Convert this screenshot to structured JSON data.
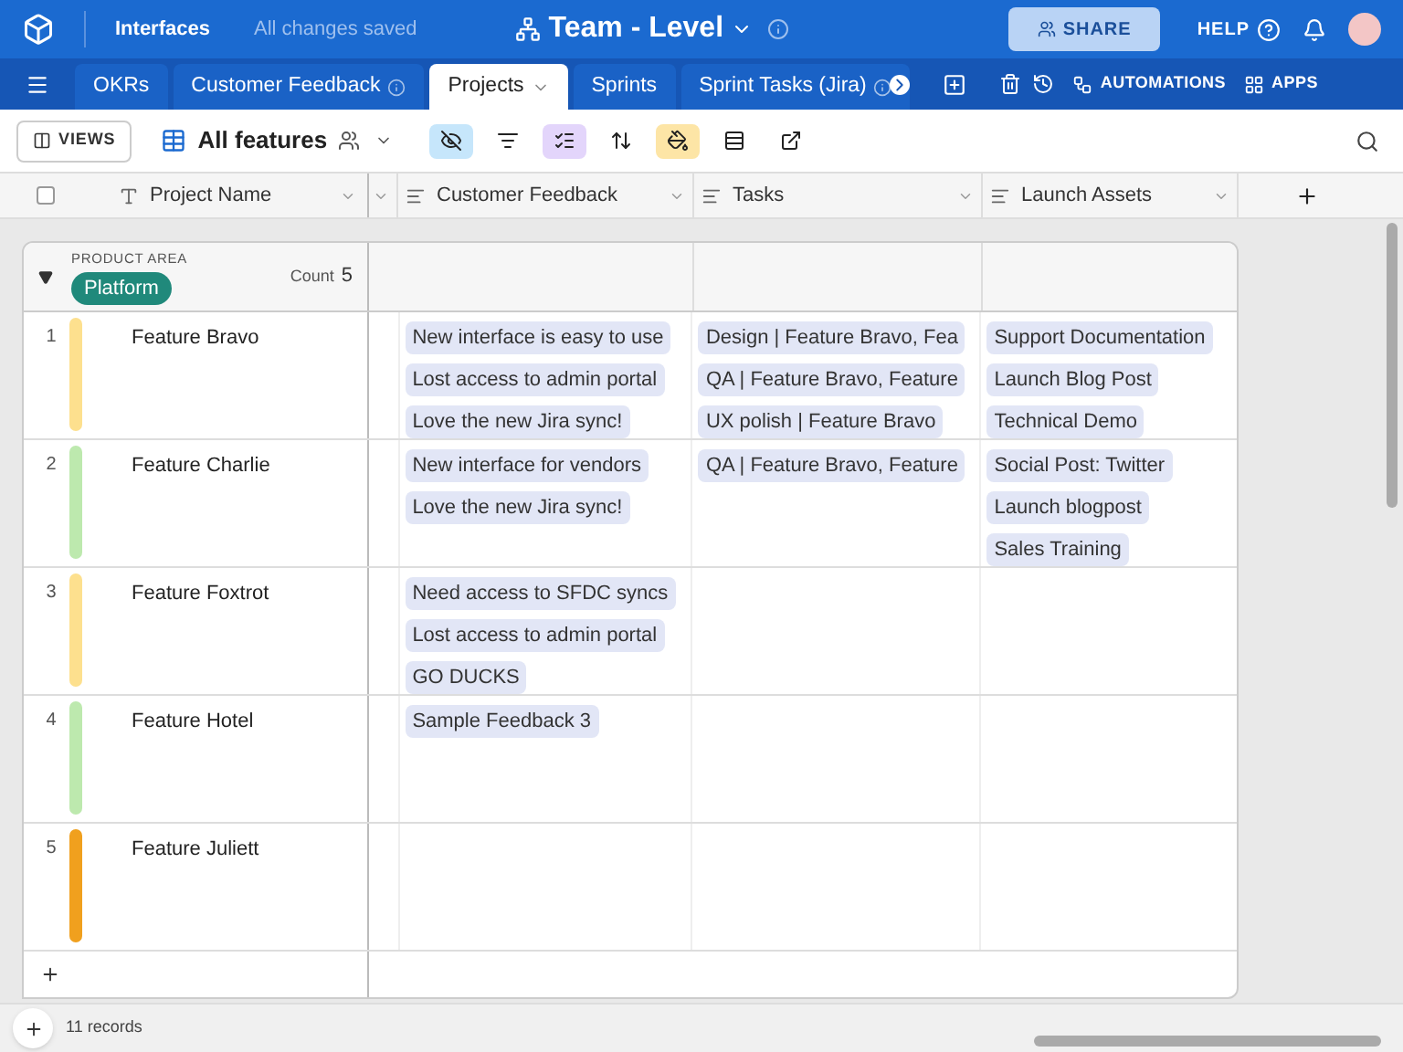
{
  "topbar": {
    "interfaces": "Interfaces",
    "status": "All changes saved",
    "title": "Team - Level",
    "share": "SHARE",
    "help": "HELP"
  },
  "tabs": [
    {
      "label": "OKRs",
      "selected": false,
      "info": false
    },
    {
      "label": "Customer Feedback",
      "selected": false,
      "info": true
    },
    {
      "label": "Projects",
      "selected": true,
      "info": false
    },
    {
      "label": "Sprints",
      "selected": false,
      "info": false
    },
    {
      "label": "Sprint Tasks (Jira)",
      "selected": false,
      "info": true
    }
  ],
  "tab_actions": {
    "automations": "AUTOMATIONS",
    "apps": "APPS"
  },
  "toolbar": {
    "views": "VIEWS",
    "view_name": "All features",
    "tools": [
      {
        "kind": "hide",
        "active": true,
        "color": "#c6e6fb"
      },
      {
        "kind": "filter",
        "active": false
      },
      {
        "kind": "group",
        "active": true,
        "color": "#e3d5fb"
      },
      {
        "kind": "sort",
        "active": false
      },
      {
        "kind": "color",
        "active": true,
        "color": "#fde5a6"
      },
      {
        "kind": "height",
        "active": false
      },
      {
        "kind": "share",
        "active": false
      }
    ]
  },
  "select_all": {
    "checked": false
  },
  "columns": [
    "Project Name",
    "Customer Feedback",
    "Tasks",
    "Launch Assets"
  ],
  "group": {
    "field": "PRODUCT AREA",
    "value": "Platform",
    "count_label": "Count",
    "count": "5",
    "expanded": true
  },
  "rows": [
    {
      "number": "1",
      "name": "Feature Bravo",
      "color": "#fde08e",
      "feedback": [
        "New interface is easy to use",
        "Lost access to admin portal",
        "Love the new Jira sync!"
      ],
      "tasks": [
        "Design | Feature Bravo, Fea",
        "QA | Feature Bravo, Feature",
        "UX polish | Feature Bravo"
      ],
      "assets": [
        "Support Documentation",
        "Launch Blog Post",
        "Technical Demo"
      ]
    },
    {
      "number": "2",
      "name": "Feature Charlie",
      "color": "#bde9ae",
      "feedback": [
        "New interface for vendors",
        "Love the new Jira sync!"
      ],
      "tasks": [
        "QA | Feature Bravo, Feature"
      ],
      "assets": [
        "Social Post: Twitter",
        "Launch blogpost",
        "Sales Training"
      ]
    },
    {
      "number": "3",
      "name": "Feature Foxtrot",
      "color": "#fde08e",
      "feedback": [
        "Need access to SFDC syncs",
        "Lost access to admin portal",
        "GO DUCKS"
      ],
      "tasks": [],
      "assets": []
    },
    {
      "number": "4",
      "name": "Feature Hotel",
      "color": "#bde9ae",
      "feedback": [
        "Sample Feedback 3"
      ],
      "tasks": [],
      "assets": []
    },
    {
      "number": "5",
      "name": "Feature Juliett",
      "color": "#f0a01e",
      "feedback": [],
      "tasks": [],
      "assets": []
    }
  ],
  "footer": {
    "records": "11 records"
  }
}
